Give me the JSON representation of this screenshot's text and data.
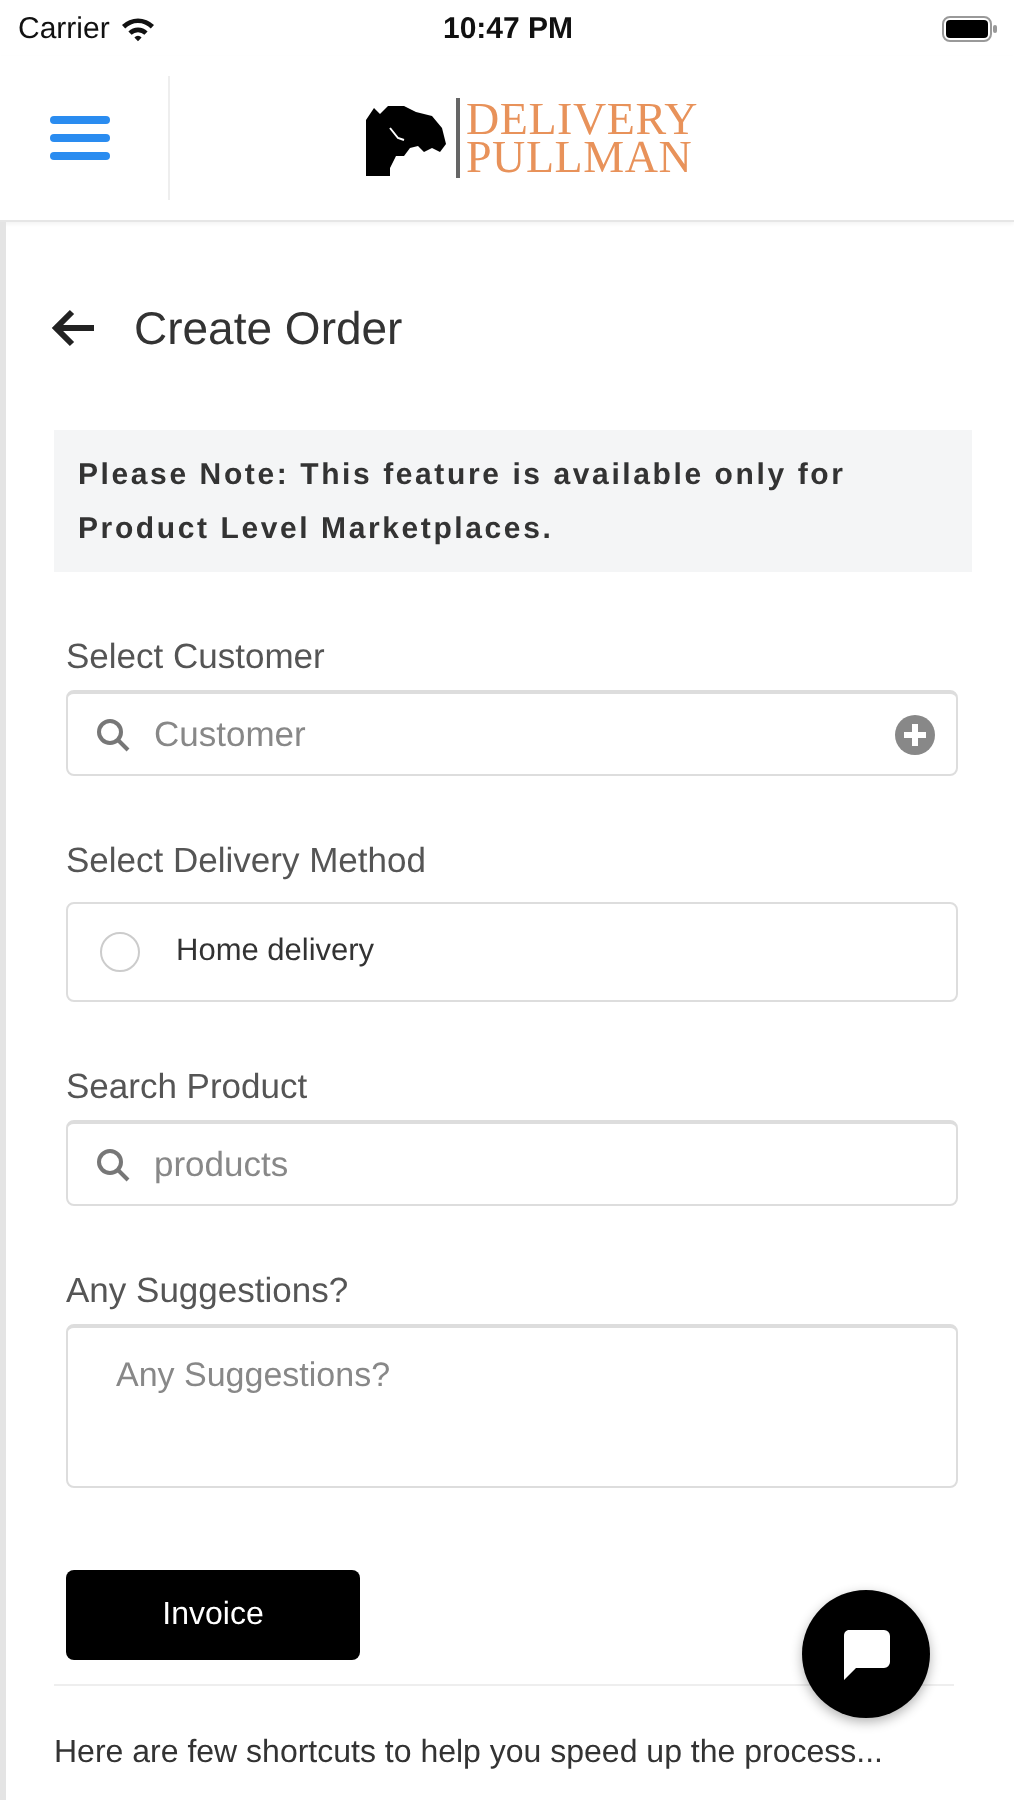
{
  "status_bar": {
    "carrier": "Carrier",
    "time": "10:47 PM"
  },
  "nav": {
    "logo_lines": [
      "DELIVERY",
      "PULLMAN"
    ]
  },
  "page": {
    "title": "Create Order",
    "note": "Please Note: This feature is available only for Product Level Marketplaces.",
    "fields": [
      {
        "kind": "search",
        "label": "Select Customer",
        "placeholder": "Customer",
        "add": true
      },
      {
        "kind": "radio",
        "label": "Select Delivery Method",
        "option": "Home delivery",
        "selected": false
      },
      {
        "kind": "search",
        "label": "Search Product",
        "placeholder": "products",
        "add": false
      },
      {
        "kind": "textarea",
        "label": "Any Suggestions?",
        "placeholder": "Any Suggestions?"
      }
    ],
    "button": "Invoice",
    "footer_text": "Here are few shortcuts to help you speed up the process..."
  }
}
